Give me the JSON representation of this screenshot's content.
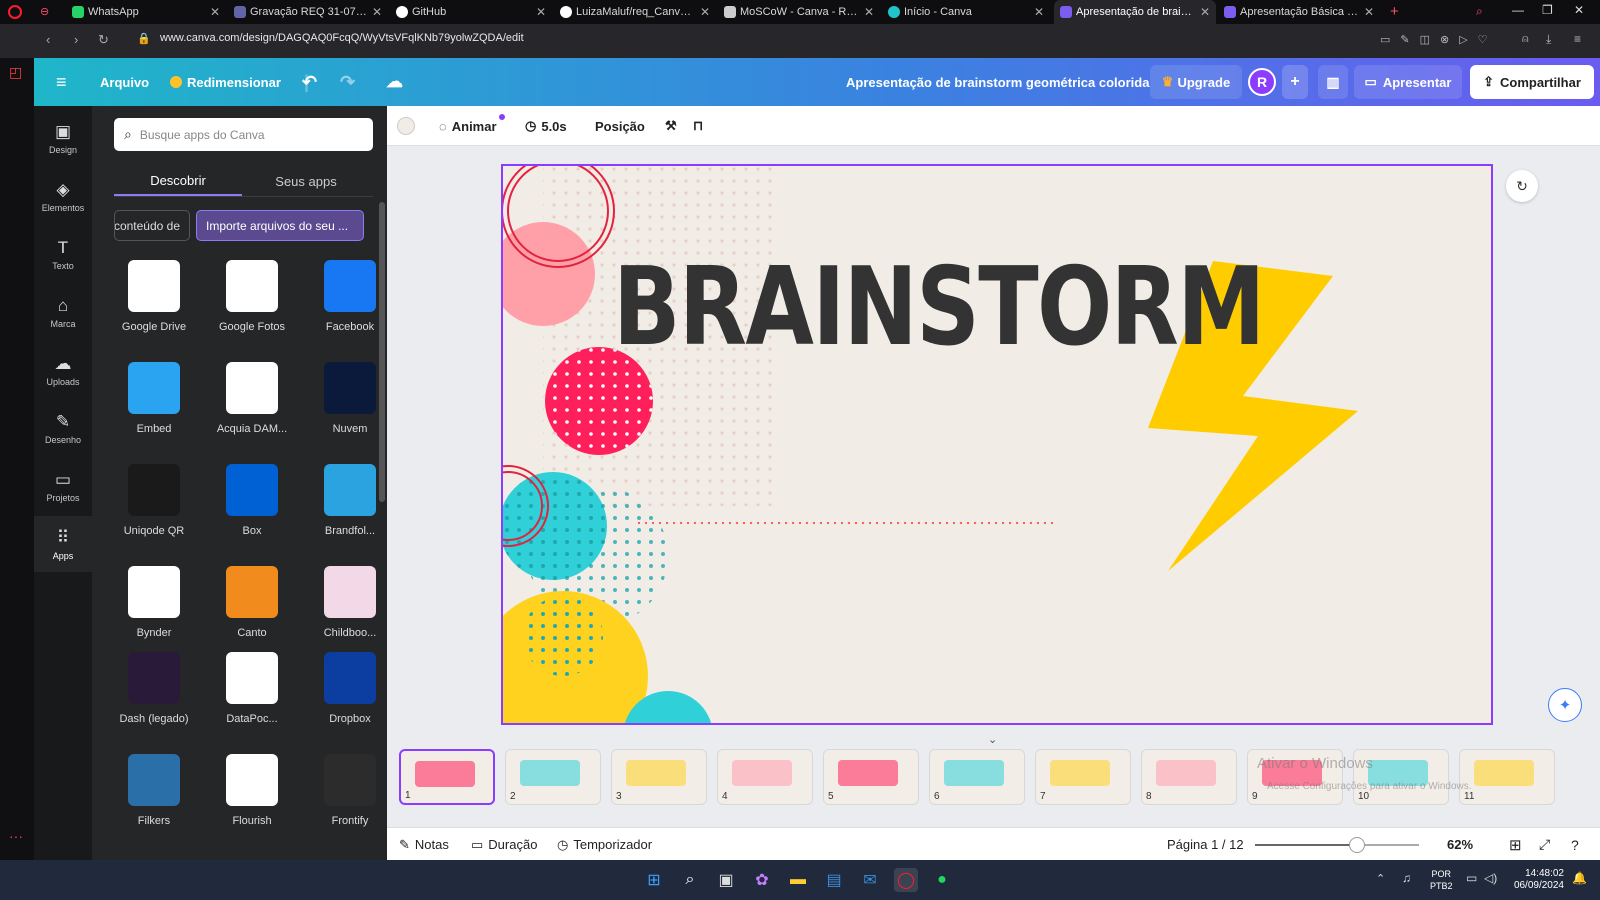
{
  "browser": {
    "tabs": [
      {
        "label": "WhatsApp"
      },
      {
        "label": "Gravação REQ 31-07 | M"
      },
      {
        "label": "GitHub"
      },
      {
        "label": "LuizaMaluf/req_Canva_202"
      },
      {
        "label": "MoSCoW - Canva - Requisi"
      },
      {
        "label": "Início - Canva"
      },
      {
        "label": "Apresentação de brainstorm"
      },
      {
        "label": "Apresentação Básica Simp"
      }
    ],
    "url": "www.canva.com/design/DAGQAQ0FcqQ/WyVtsVFqlKNb79yolwZQDA/edit"
  },
  "header": {
    "menu_label": "Arquivo",
    "resize_label": "Redimensionar",
    "doc_title": "Apresentação de brainstorm geométrica colorida",
    "upgrade_label": "Upgrade",
    "avatar_letter": "R",
    "present_label": "Apresentar",
    "share_label": "Compartilhar"
  },
  "rail": {
    "items": [
      {
        "label": "Design"
      },
      {
        "label": "Elementos"
      },
      {
        "label": "Texto"
      },
      {
        "label": "Marca"
      },
      {
        "label": "Uploads"
      },
      {
        "label": "Desenho"
      },
      {
        "label": "Projetos"
      },
      {
        "label": "Apps"
      }
    ]
  },
  "panel": {
    "search_placeholder": "Busque apps do Canva",
    "tabs": [
      {
        "label": "Descobrir"
      },
      {
        "label": "Seus apps"
      }
    ],
    "chips": [
      {
        "label": "conteúdo de"
      },
      {
        "label": "Importe arquivos do seu ..."
      }
    ],
    "apps": [
      {
        "label": "Google Drive",
        "color": "#ffffff"
      },
      {
        "label": "Google Fotos",
        "color": "#ffffff"
      },
      {
        "label": "Facebook",
        "color": "#1877f2"
      },
      {
        "label": "Embed",
        "color": "#2aa3f0"
      },
      {
        "label": "Acquia DAM...",
        "color": "#ffffff"
      },
      {
        "label": "Nuvem",
        "color": "#0b1a3a"
      },
      {
        "label": "Uniqode QR",
        "color": "#1a1a1a"
      },
      {
        "label": "Box",
        "color": "#0061d5"
      },
      {
        "label": "Brandfol...",
        "color": "#2aa3e0"
      },
      {
        "label": "Bynder",
        "color": "#ffffff"
      },
      {
        "label": "Canto",
        "color": "#f28b1e"
      },
      {
        "label": "Childboo...",
        "color": "#f3d9e8"
      },
      {
        "label": "Dash (legado)",
        "color": "#2a1a3a"
      },
      {
        "label": "DataPoc...",
        "color": "#ffffff"
      },
      {
        "label": "Dropbox",
        "color": "#0c3da0"
      },
      {
        "label": "Filkers",
        "color": "#2a6fa8"
      },
      {
        "label": "Flourish",
        "color": "#ffffff"
      },
      {
        "label": "Frontify",
        "color": "#2c2c2c"
      }
    ]
  },
  "context_toolbar": {
    "animate_label": "Animar",
    "duration_label": "5.0s",
    "position_label": "Posição"
  },
  "slide": {
    "title": "BRAINSTORM"
  },
  "thumbnails": [
    {
      "number": "1"
    },
    {
      "number": "2"
    },
    {
      "number": "3"
    },
    {
      "number": "4"
    },
    {
      "number": "5"
    },
    {
      "number": "6"
    },
    {
      "number": "7"
    },
    {
      "number": "8"
    },
    {
      "number": "9"
    },
    {
      "number": "10"
    },
    {
      "number": "11"
    }
  ],
  "footer": {
    "notes_label": "Notas",
    "duration_label": "Duração",
    "timer_label": "Temporizador",
    "page_indicator": "Página 1 / 12",
    "zoom_label": "62%",
    "zoom_value": 0.62
  },
  "watermark": {
    "line1": "Ativar o Windows",
    "line2": "Acesse Configurações para ativar o Windows."
  },
  "taskbar": {
    "lang_line1": "POR",
    "lang_line2": "PTB2",
    "time": "14:48:02",
    "date": "06/09/2024"
  },
  "colors": {
    "accent": "#8b3dff",
    "pink": "#ff1f5a",
    "teal": "#2fd0d8",
    "yellow": "#ffd21f",
    "bolt": "#ffcc00"
  }
}
